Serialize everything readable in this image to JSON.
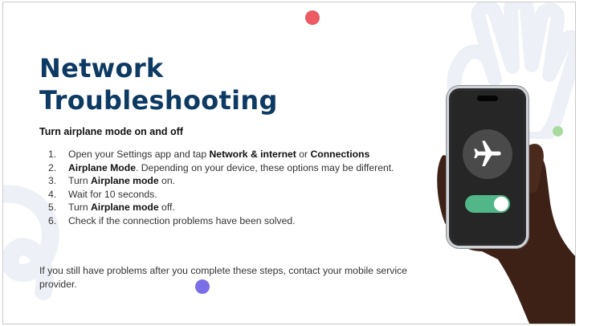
{
  "slide": {
    "title_line1": "Network",
    "title_line2": "Troubleshooting",
    "subtitle": "Turn airplane mode on and off",
    "steps": [
      {
        "num": "1.",
        "parts": [
          "Open your Settings app and tap ",
          "Network & internet",
          " or ",
          "Connections"
        ]
      },
      {
        "num": "2.",
        "parts": [
          " ",
          "Airplane Mode",
          ". Depending on your device, these options may be different."
        ]
      },
      {
        "num": "3.",
        "parts": [
          "Turn ",
          "Airplane mode",
          " on."
        ]
      },
      {
        "num": "4.",
        "parts": [
          "Wait for 10 seconds."
        ]
      },
      {
        "num": "5.",
        "parts": [
          "Turn ",
          "Airplane mode",
          " off."
        ]
      },
      {
        "num": "6.",
        "parts": [
          "Check if the connection problems have been solved."
        ]
      }
    ],
    "footer_note": "If you still have problems after you complete these steps, contact your mobile service provider."
  },
  "phone": {
    "icon": "airplane-icon",
    "toggle_state": "on"
  },
  "colors": {
    "title": "#0d3a63",
    "dot_red": "#ec5a63",
    "dot_green": "#a8dc9e",
    "dot_purple": "#7b6ee6",
    "toggle": "#52b788",
    "decor": "#eef0f7"
  }
}
